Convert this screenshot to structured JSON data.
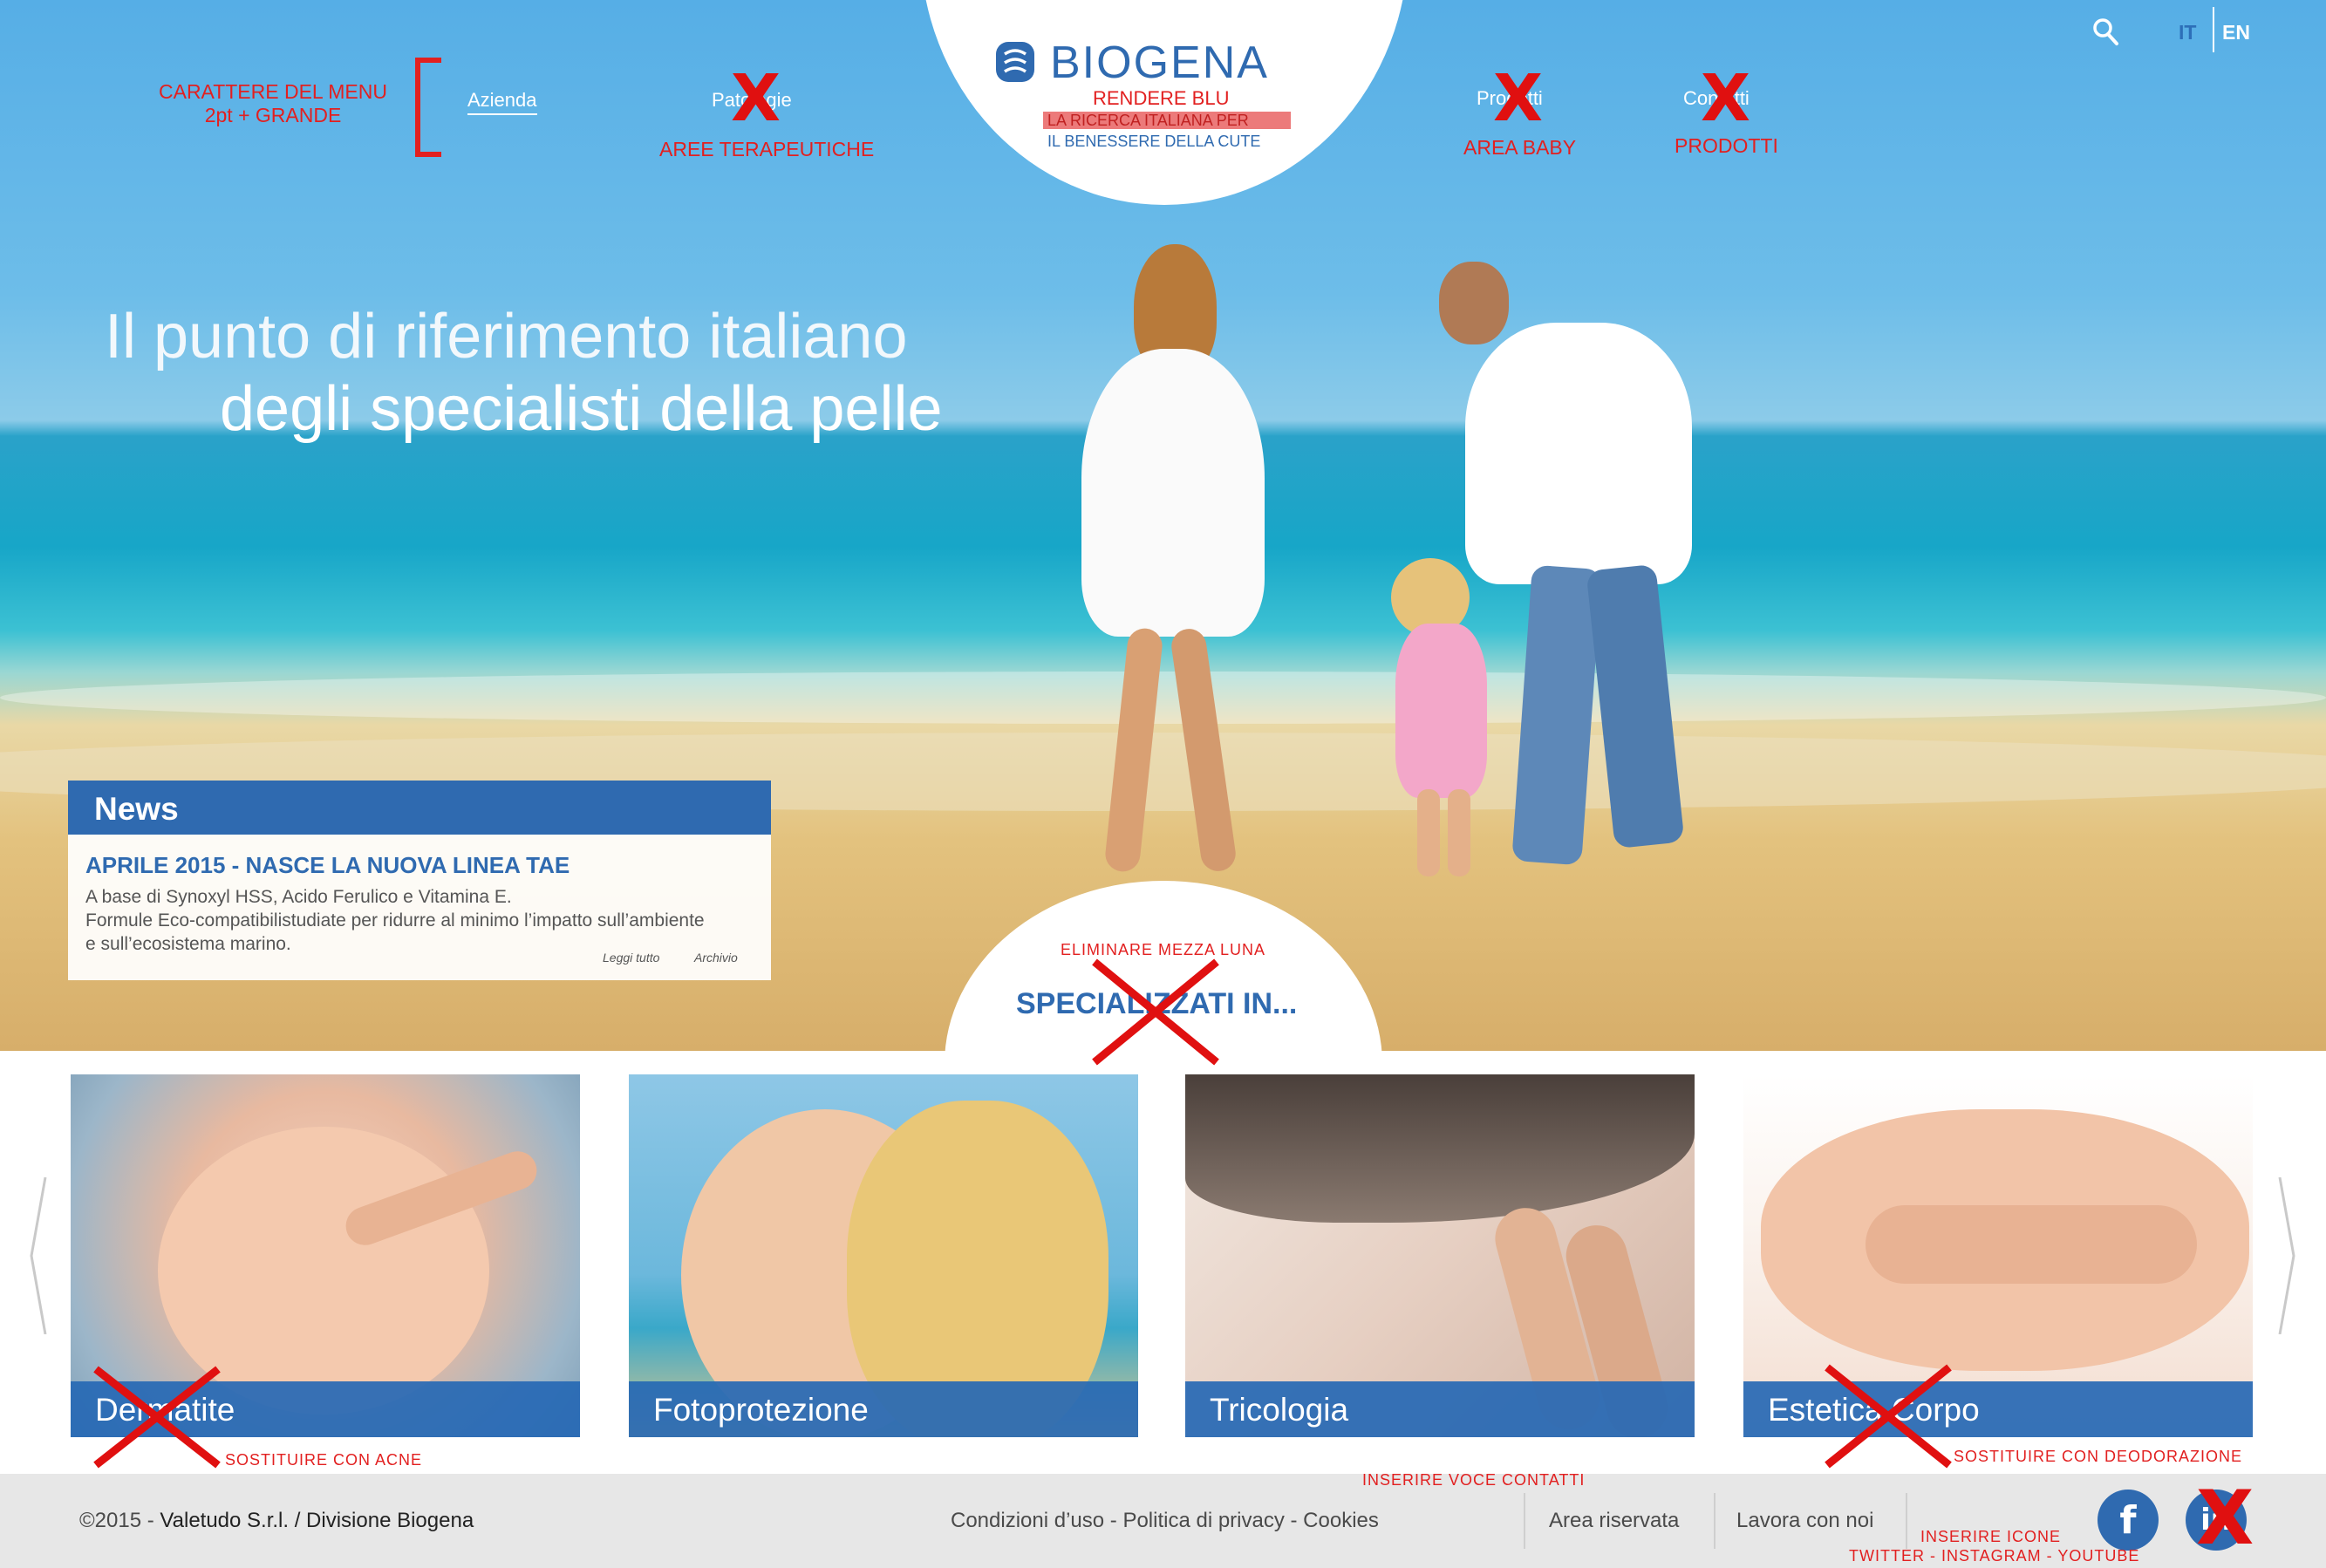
{
  "header": {
    "menu_note_line1": "CARATTERE DEL MENU",
    "menu_note_line2": "2pt + GRANDE",
    "nav": {
      "azienda": "Azienda",
      "patologie": "Patologie",
      "patologie_note": "AREE TERAPEUTICHE",
      "prodotti": "Prodotti",
      "prodotti_note": "AREA BABY",
      "contatti": "Contatti",
      "contatti_note": "PRODOTTI"
    },
    "lang_it": "IT",
    "lang_en": "EN",
    "search_icon": "search-icon"
  },
  "logo": {
    "brand": "BIOGENA",
    "note": "RENDERE BLU",
    "tagline1": "LA RICERCA ITALIANA PER",
    "tagline2": "IL BENESSERE DELLA CUTE"
  },
  "hero": {
    "line1": "Il punto di riferimento italiano",
    "line2": "degli specialisti della pelle"
  },
  "news": {
    "heading": "News",
    "title": "APRILE 2015 - NASCE LA NUOVA LINEA TAE",
    "body1": "A base di Synoxyl HSS, Acido Ferulico e Vitamina E.",
    "body2": "Formule Eco-compatibilistudiate per ridurre al minimo l’impatto sull’ambiente",
    "body3": "e sull’ecosistema marino.",
    "read_more": "Leggi tutto",
    "archive": "Archivio"
  },
  "specialized": {
    "note": "ELIMINARE MEZZA LUNA",
    "label": "SPECIALIZZATI IN..."
  },
  "cards": [
    {
      "label": "Dermatite",
      "note": "SOSTITUIRE CON ACNE"
    },
    {
      "label": "Fotoprotezione"
    },
    {
      "label": "Tricologia"
    },
    {
      "label": "Estetica Corpo",
      "note": "SOSTITUIRE CON DEODORAZIONE"
    }
  ],
  "footer": {
    "copyright_year": "©2015 - ",
    "company": "Valetudo S.r.l. / Divisione Biogena",
    "links": "Condizioni d’uso - Politica di privacy - Cookies",
    "contacts_note": "INSERIRE VOCE CONTATTI",
    "area_riservata": "Area riservata",
    "lavora": "Lavora con noi",
    "icons_note1": "INSERIRE ICONE",
    "icons_note2": "TWITTER - INSTAGRAM - YOUTUBE",
    "facebook": "f",
    "linkedin": "in"
  },
  "colors": {
    "brand_blue": "#2f6ab0",
    "annotation_red": "#e22020",
    "footer_bg": "#e7e7e7"
  }
}
